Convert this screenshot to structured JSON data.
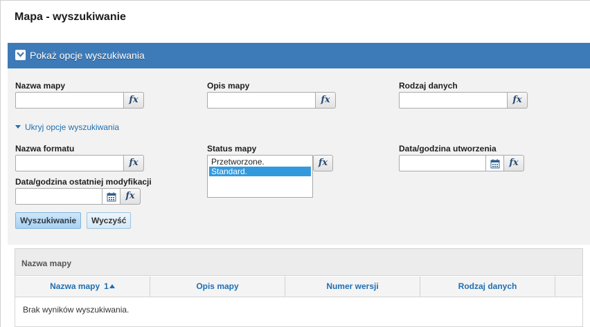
{
  "page": {
    "title": "Mapa - wyszukiwanie"
  },
  "search_panel": {
    "header_label": "Pokaż opcje wyszukiwania",
    "toggle_link": "Ukryj opcje wyszukiwania",
    "fields": {
      "map_name": {
        "label": "Nazwa mapy",
        "value": ""
      },
      "map_description": {
        "label": "Opis mapy",
        "value": ""
      },
      "data_type": {
        "label": "Rodzaj danych",
        "value": ""
      },
      "format_name": {
        "label": "Nazwa formatu",
        "value": ""
      },
      "map_status": {
        "label": "Status mapy",
        "options": [
          "Przetworzone.",
          "Standard."
        ],
        "selected": "Standard."
      },
      "created_datetime": {
        "label": "Data/godzina utworzenia",
        "value": ""
      },
      "modified_datetime": {
        "label": "Data/godzina ostatniej modyfikacji",
        "value": ""
      }
    },
    "fx_label": "fx",
    "buttons": {
      "search": "Wyszukiwanie",
      "clear": "Wyczyść"
    }
  },
  "results": {
    "title": "Nazwa mapy",
    "columns": [
      {
        "label": "Nazwa mapy",
        "sort_index": "1",
        "sort": "asc"
      },
      {
        "label": "Opis mapy"
      },
      {
        "label": "Numer wersji"
      },
      {
        "label": "Rodzaj danych"
      }
    ],
    "empty_message": "Brak wyników wyszukiwania."
  },
  "colors": {
    "header_blue": "#3d7ab8",
    "link_blue": "#1f6fb2",
    "selection": "#3399dd"
  },
  "icons": {
    "panel_toggle": "checkbox-check-icon",
    "date_picker": "calendar-icon",
    "sort": "sort-ascending-icon"
  }
}
